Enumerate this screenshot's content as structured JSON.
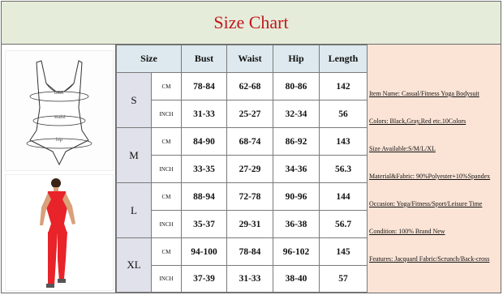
{
  "title": "Size Chart",
  "table": {
    "headers": [
      "Size",
      "Bust",
      "Waist",
      "Hip",
      "Length"
    ],
    "rows": [
      {
        "size": "S",
        "cm": {
          "unit": "CM",
          "bust": "78-84",
          "waist": "62-68",
          "hip": "80-86",
          "length": "142"
        },
        "inch": {
          "unit": "INCH",
          "bust": "31-33",
          "waist": "25-27",
          "hip": "32-34",
          "length": "56"
        }
      },
      {
        "size": "M",
        "cm": {
          "unit": "CM",
          "bust": "84-90",
          "waist": "68-74",
          "hip": "86-92",
          "length": "143"
        },
        "inch": {
          "unit": "INCH",
          "bust": "33-35",
          "waist": "27-29",
          "hip": "34-36",
          "length": "56.3"
        }
      },
      {
        "size": "L",
        "cm": {
          "unit": "CM",
          "bust": "88-94",
          "waist": "72-78",
          "hip": "90-96",
          "length": "144"
        },
        "inch": {
          "unit": "INCH",
          "bust": "35-37",
          "waist": "29-31",
          "hip": "36-38",
          "length": "56.7"
        }
      },
      {
        "size": "XL",
        "cm": {
          "unit": "CM",
          "bust": "94-100",
          "waist": "78-84",
          "hip": "96-102",
          "length": "145"
        },
        "inch": {
          "unit": "INCH",
          "bust": "37-39",
          "waist": "31-33",
          "hip": "38-40",
          "length": "57"
        }
      }
    ]
  },
  "diagram_labels": {
    "bust": "bust",
    "waist": "waist",
    "hip": "hip"
  },
  "info": [
    "Item Name: Casual/Fitness Yoga Bodysuit",
    "Colors: Black,Gray,Red etc.10Colors",
    "Size Available:S/M/L/XL",
    "Material&Fabric: 90%Polyester+10%Spandex",
    "Occasion: Yoga/Fitness/Sport/Leisure Time",
    "Condition: 100% Brand New",
    "Features: Jacquard Fabric/Scrunch/Back-cross"
  ],
  "colors": {
    "title": "#c0181c",
    "title_bg": "#e6ecda",
    "header_bg": "#dde9ee",
    "size_bg": "#e1e1ec",
    "info_bg": "#fbe4d6",
    "suit": "#e8232a"
  }
}
